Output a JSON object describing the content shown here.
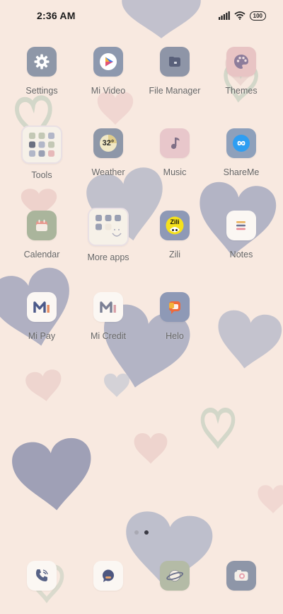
{
  "status": {
    "time": "2:36 AM",
    "battery": "100"
  },
  "apps": [
    {
      "label": "Settings"
    },
    {
      "label": "Mi Video"
    },
    {
      "label": "File Manager"
    },
    {
      "label": "Themes"
    },
    {
      "label": "Tools"
    },
    {
      "label": "Weather",
      "temp": "32°"
    },
    {
      "label": "Music"
    },
    {
      "label": "ShareMe"
    },
    {
      "label": "Calendar"
    },
    {
      "label": "More apps"
    },
    {
      "label": "Zili",
      "logo_text": "Zili"
    },
    {
      "label": "Notes"
    },
    {
      "label": "Mi Pay"
    },
    {
      "label": "Mi Credit"
    },
    {
      "label": "Helo"
    }
  ],
  "pager": {
    "pages": 2,
    "active": 2
  },
  "colors": {
    "background": "#f8e9e0",
    "heart_blue": "#9fa3b8",
    "heart_pink": "#eed4cf",
    "heart_sage": "#cfd5c6"
  }
}
